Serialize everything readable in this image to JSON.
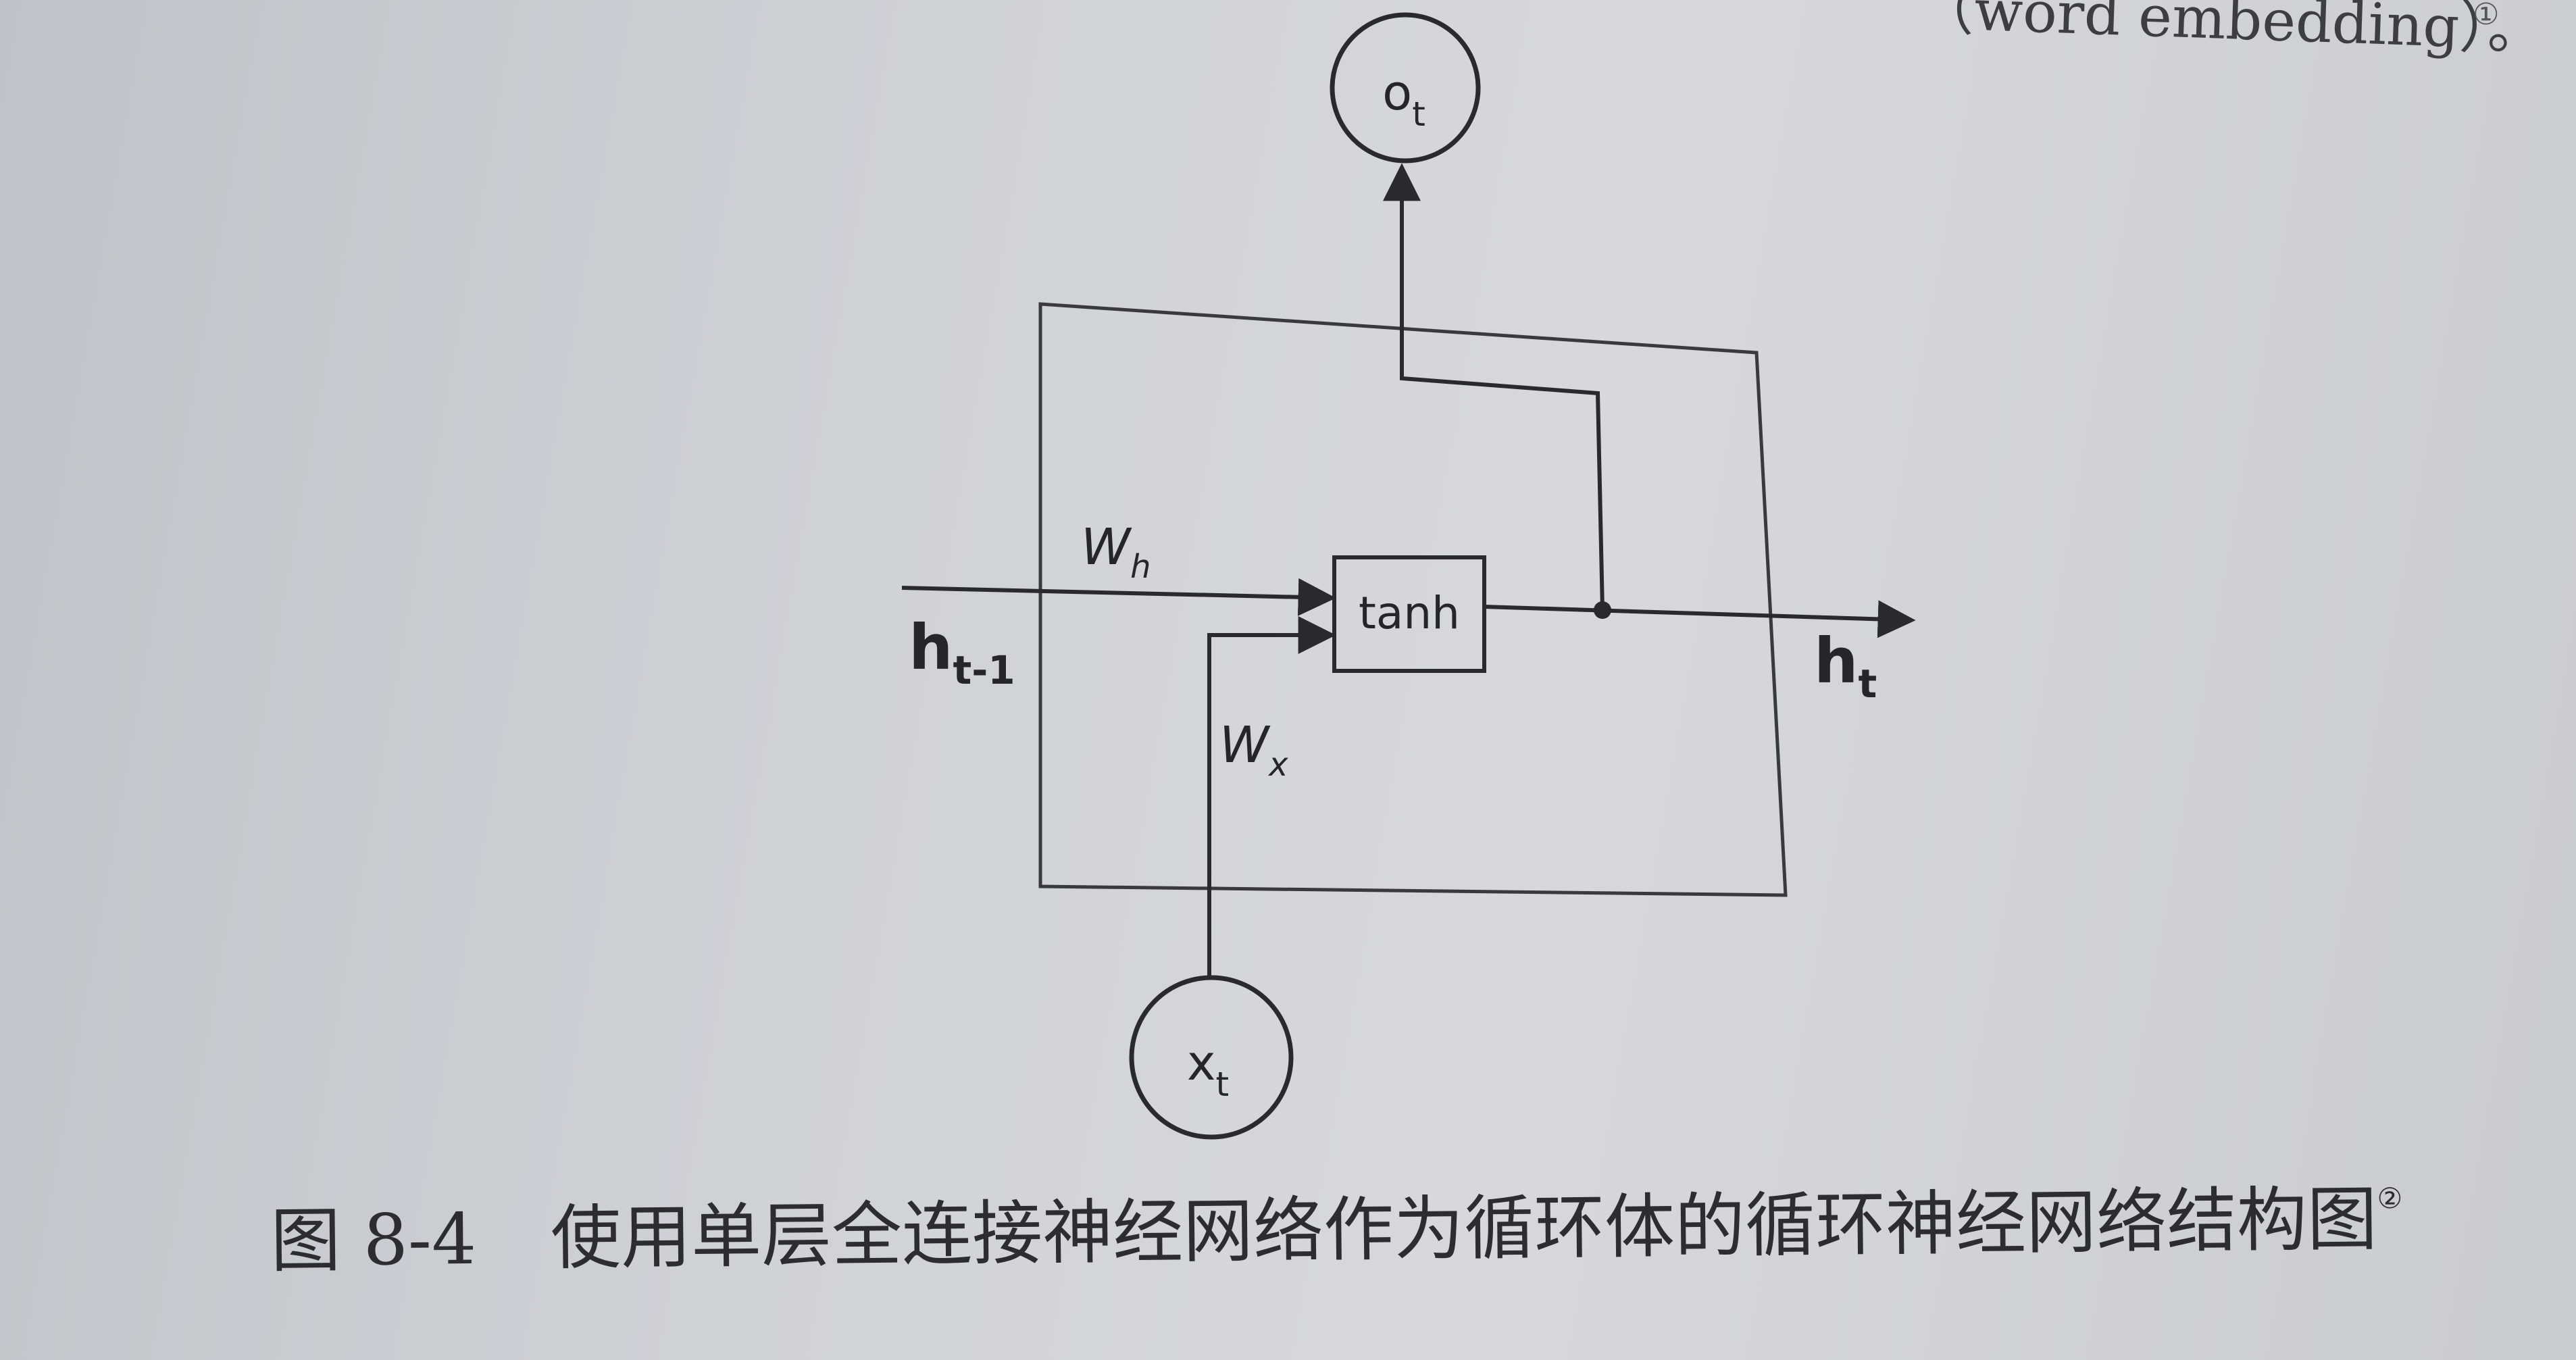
{
  "top_text": "（word embedding）。",
  "top_note": "①",
  "nodes": {
    "output": {
      "base": "o",
      "sub": "t"
    },
    "input": {
      "base": "x",
      "sub": "t"
    },
    "activation": "tanh"
  },
  "labels": {
    "prev_hidden": {
      "base": "h",
      "sub": "t-1"
    },
    "next_hidden": {
      "base": "h",
      "sub": "t"
    },
    "weight_hidden": {
      "base": "W",
      "sub": "h"
    },
    "weight_input": {
      "base": "W",
      "sub": "x"
    }
  },
  "caption": {
    "number": "图 8-4",
    "text": "使用单层全连接神经网络作为循环体的循环神经网络结构图",
    "note": "②"
  }
}
